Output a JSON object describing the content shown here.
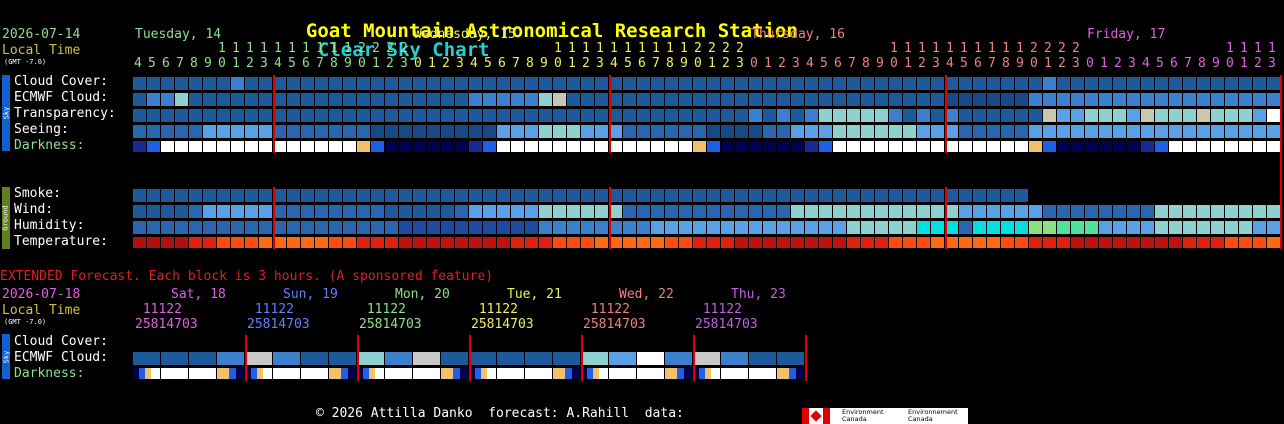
{
  "header": {
    "title": "Goat Mountain Astronomical Research Station",
    "subtitle": "Clear Sky Chart",
    "title_color": "#ffff00",
    "subtitle_color": "#22d0d0"
  },
  "main": {
    "date": "2026-07-14",
    "local_time_label": "Local Time",
    "gmt_label": "(GMT -7.0)",
    "days": [
      {
        "label": "Tuesday, 14",
        "color": "#8ee08e"
      },
      {
        "label": "Wednesday, 15",
        "color": "#f0f060"
      },
      {
        "label": "Thursday, 16",
        "color": "#f08080"
      },
      {
        "label": "Friday, 17",
        "color": "#e060e0"
      }
    ],
    "sky_label": "Sky",
    "ground_label": "Ground",
    "sky_rows": [
      "Cloud Cover:",
      "ECMWF Cloud:",
      "Transparency:",
      "Seeing:",
      "Darkness:"
    ],
    "ground_rows": [
      "Smoke:",
      "Wind:",
      "Humidity:",
      "Temperature:"
    ]
  },
  "extended": {
    "notice": "EXTENDED Forecast. Each block is 3 hours. (A sponsored feature)",
    "date": "2026-07-18",
    "local_time_label": "Local Time",
    "gmt_label": "(GMT -7.0)",
    "days": [
      {
        "label": "Sat, 18",
        "color": "#e060e0"
      },
      {
        "label": "Sun, 19",
        "color": "#6080ff"
      },
      {
        "label": "Mon, 20",
        "color": "#8ee08e"
      },
      {
        "label": "Tue, 21",
        "color": "#f0f060"
      },
      {
        "label": "Wed, 22",
        "color": "#f08080"
      },
      {
        "label": "Thu, 23",
        "color": "#c060e0"
      }
    ],
    "hours_top": " 11122",
    "hours_bottom": "25814703",
    "sky_rows": [
      "Cloud Cover:",
      "ECMWF Cloud:",
      "Darkness:"
    ]
  },
  "footer": {
    "credits": "© 2026 Attilla Danko  forecast: A.Rahill  data:",
    "logo_text_en": "Environment Canada",
    "logo_text_fr": "Environnement Canada"
  }
}
